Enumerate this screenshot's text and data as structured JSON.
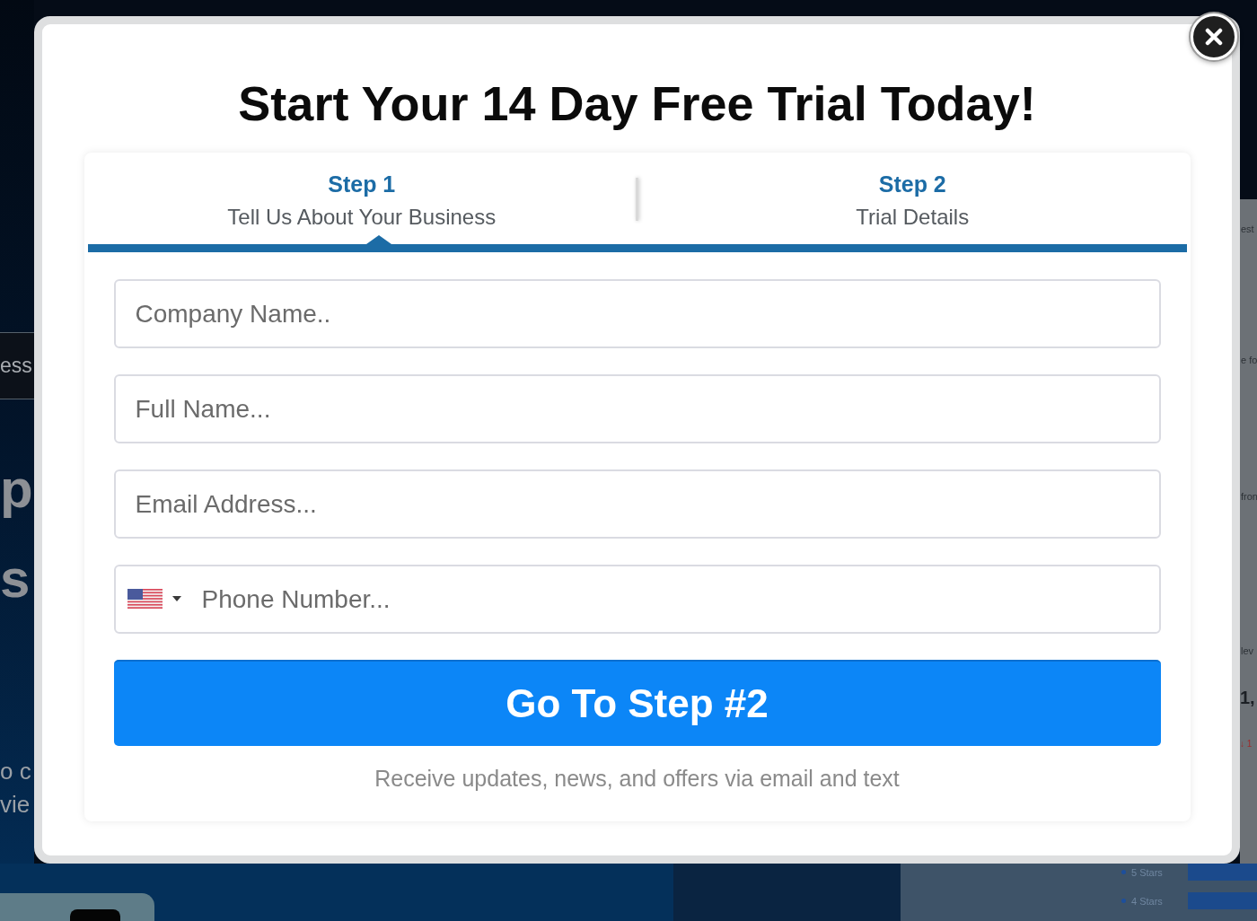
{
  "background": {
    "left_fragments": [
      {
        "kind": "nav",
        "text": "ess"
      },
      {
        "kind": "heading",
        "text": "p"
      },
      {
        "kind": "heading",
        "text": "s"
      },
      {
        "kind": "body",
        "text": "o c"
      },
      {
        "kind": "body",
        "text": "vie"
      }
    ],
    "right_fragments": [
      {
        "kind": "label",
        "text": "est"
      },
      {
        "kind": "label",
        "text": "e fo"
      },
      {
        "kind": "label",
        "text": "fron"
      },
      {
        "kind": "label",
        "text": "lev"
      },
      {
        "kind": "stat",
        "text": "1,"
      },
      {
        "kind": "change",
        "text": "↓ 1"
      }
    ],
    "legend": [
      "5 Stars",
      "4 Stars"
    ]
  },
  "modal": {
    "title": "Start Your 14 Day Free Trial Today!",
    "steps": [
      {
        "label": "Step 1",
        "description": "Tell Us About Your Business",
        "selected": true
      },
      {
        "label": "Step 2",
        "description": "Trial Details",
        "selected": false
      }
    ],
    "fields": [
      {
        "kind": "text",
        "placeholder": "Company Name.."
      },
      {
        "kind": "text",
        "placeholder": "Full Name..."
      },
      {
        "kind": "text",
        "placeholder": "Email Address..."
      },
      {
        "kind": "phone",
        "placeholder": "Phone Number..."
      }
    ],
    "submit": "Go To Step #2",
    "note": "Receive updates, news, and offers via email and text"
  }
}
